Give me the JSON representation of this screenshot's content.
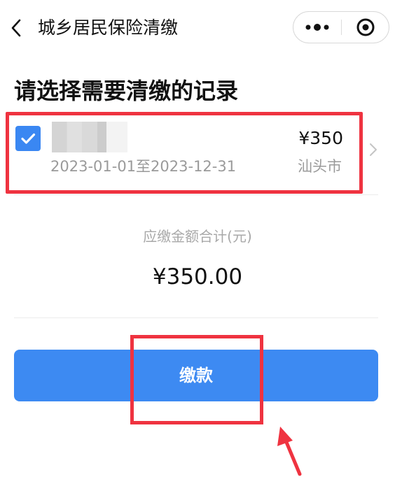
{
  "header": {
    "title": "城乡居民保险清缴",
    "back_icon": "back-chevron-icon",
    "more_icon": "more-dots-icon",
    "close_icon": "close-target-icon"
  },
  "page": {
    "heading": "请选择需要清缴的记录"
  },
  "records": [
    {
      "checked": true,
      "name": "",
      "period": "2023-01-01至2023-12-31",
      "amount": "¥350",
      "city": "汕头市"
    }
  ],
  "summary": {
    "label": "应缴金额合计(元)",
    "total": "¥350.00"
  },
  "actions": {
    "pay_label": "缴款"
  },
  "colors": {
    "primary": "#3d8af2",
    "checkbox": "#3a87f2",
    "annotation": "#ef3340",
    "muted_text": "#9a9a9a"
  }
}
